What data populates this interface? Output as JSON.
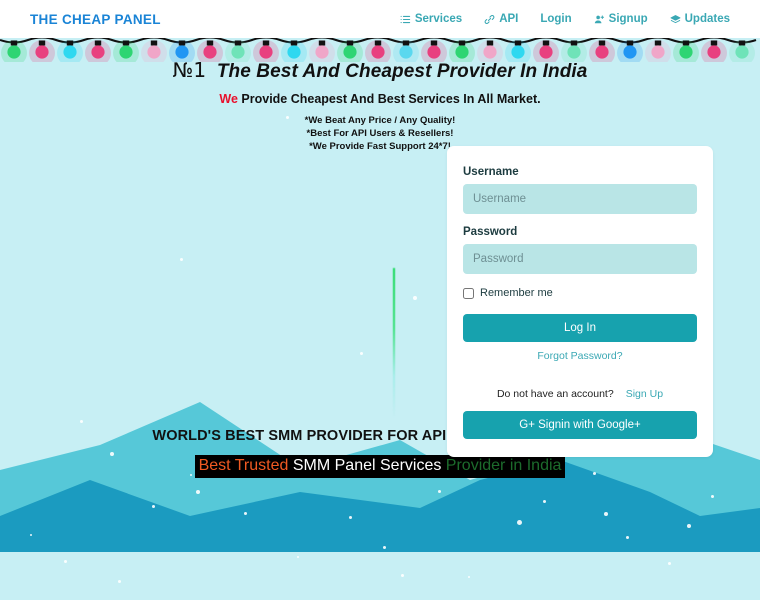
{
  "navbar": {
    "brand": "THE CHEAP PANEL",
    "links": [
      {
        "label": "Services",
        "icon": "list-icon"
      },
      {
        "label": "API",
        "icon": "link-icon"
      },
      {
        "label": "Login",
        "icon": "none"
      },
      {
        "label": "Signup",
        "icon": "user-plus-icon"
      },
      {
        "label": "Updates",
        "icon": "layers-icon"
      }
    ]
  },
  "hero": {
    "badge": "№1",
    "title": "The Best And Cheapest Provider In India",
    "sub_highlight": "We",
    "sub_rest": " Provide Cheapest And Best Services In All Market.",
    "bullets": [
      "*We Beat Any Price / Any Quality!",
      "*Best For API Users & Resellers!",
      "*We Provide Fast Support 24*7!"
    ]
  },
  "login": {
    "username_label": "Username",
    "username_placeholder": "Username",
    "username_value": "",
    "password_label": "Password",
    "password_placeholder": "Password",
    "password_value": "",
    "remember_label": "Remember me",
    "login_button": "Log In",
    "forgot_link": "Forgot Password?",
    "account_question": "Do not have an account?",
    "signup_link": "Sign Up",
    "google_button": "G+ Signin with Google+"
  },
  "bottom": {
    "title": "WORLD'S BEST SMM PROVIDER FOR API USERS & RESELLERS",
    "typed_orange": "Best Trusted",
    "typed_white": " SMM Panel Services ",
    "typed_green": "Provider  in India"
  },
  "colors": {
    "brand_blue": "#1a84d6",
    "nav_teal": "#3aa8b4",
    "background_cyan": "#c7eff4",
    "button_teal": "#17a2ae",
    "input_teal": "#b9e5e6",
    "mountain_light": "#56c8d8",
    "mountain_dark": "#1b9bc0",
    "accent_red": "#e8112d",
    "typed_orange": "#f05a22",
    "typed_green": "#1c6b2c"
  },
  "lights": {
    "bulb_colors": [
      "#2ed573",
      "#e8407f",
      "#2ed8f0",
      "#e8407f",
      "#2ed573",
      "#f0a6c8",
      "#2196f3",
      "#e8407f",
      "#6fe3b8",
      "#e8407f",
      "#2ed8f0",
      "#f0a6c8",
      "#2ed573",
      "#e8407f",
      "#5ad8ef",
      "#e8407f",
      "#2ed573",
      "#f0a6c8",
      "#2ed8f0",
      "#e8407f",
      "#6fe3b8",
      "#e8407f",
      "#2196f3",
      "#f0a6c8",
      "#2ed573",
      "#e8407f",
      "#6fe3b8"
    ]
  }
}
